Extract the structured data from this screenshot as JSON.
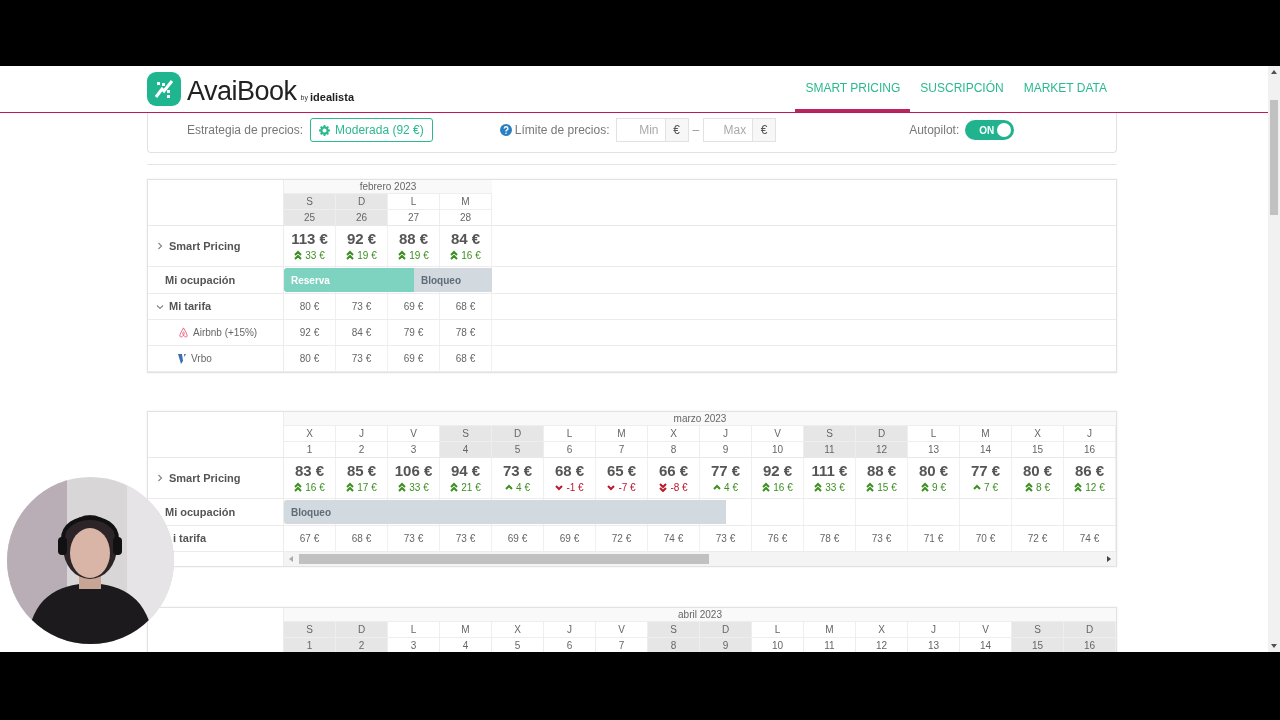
{
  "header": {
    "logo": {
      "name": "AvaiBook",
      "byline": "by",
      "partner": "idealista"
    },
    "nav": [
      {
        "label": "SMART PRICING",
        "selected": true
      },
      {
        "label": "SUSCRIPCIÓN",
        "selected": false
      },
      {
        "label": "MARKET DATA",
        "selected": false
      }
    ]
  },
  "settings": {
    "strategy_label": "Estrategia de precios:",
    "strategy_value": "Moderada (92 €)",
    "limit_label": "Límite de precios:",
    "min": {
      "placeholder": "Min",
      "unit": "€"
    },
    "separator": "–",
    "max": {
      "placeholder": "Max",
      "unit": "€"
    },
    "autopilot_label": "Autopilot:",
    "autopilot": {
      "on": true,
      "label": "ON"
    }
  },
  "sections": [
    {
      "month": "febrero 2023",
      "labels": {
        "smart_pricing": "Smart Pricing",
        "occupancy": "Mi ocupación",
        "rate": "Mi tarifa"
      },
      "smart_pricing_expanded": false,
      "rate_expanded": true,
      "bookings": [
        {
          "kind": "reserva",
          "label": "Reserva"
        },
        {
          "kind": "bloqueo",
          "label": "Bloqueo"
        }
      ],
      "channels": [
        {
          "kind": "airbnb",
          "label": "Airbnb (+15%)"
        },
        {
          "kind": "vrbo",
          "label": "Vrbo"
        }
      ],
      "days": [
        {
          "dow": "S",
          "day": "25",
          "weekend": true,
          "price": "113 €",
          "change": {
            "kind": "up2",
            "text": "33 €"
          },
          "rate": "80 €",
          "channel_prices": [
            "92 €",
            "80 €"
          ],
          "occupancy": [
            {
              "kind": "reserva"
            },
            {
              "kind": "reserva"
            }
          ]
        },
        {
          "dow": "D",
          "day": "26",
          "weekend": true,
          "price": "92 €",
          "change": {
            "kind": "up2",
            "text": "19 €"
          },
          "rate": "73 €",
          "channel_prices": [
            "84 €",
            "73 €"
          ],
          "occupancy": [
            {
              "kind": "reserva"
            },
            {
              "kind": "reserva"
            }
          ]
        },
        {
          "dow": "L",
          "day": "27",
          "weekend": false,
          "price": "88 €",
          "change": {
            "kind": "up2",
            "text": "19 €"
          },
          "rate": "69 €",
          "channel_prices": [
            "79 €",
            "69 €"
          ],
          "occupancy": [
            {
              "kind": "reserva"
            },
            {
              "kind": "bloqueo"
            }
          ]
        },
        {
          "dow": "M",
          "day": "28",
          "weekend": false,
          "price": "84 €",
          "change": {
            "kind": "up2",
            "text": "16 €"
          },
          "rate": "68 €",
          "channel_prices": [
            "78 €",
            "68 €"
          ],
          "occupancy": [
            {
              "kind": "bloqueo"
            },
            {
              "kind": "bloqueo"
            }
          ]
        }
      ]
    },
    {
      "month": "marzo 2023",
      "labels": {
        "smart_pricing": "Smart Pricing",
        "occupancy": "Mi ocupación",
        "rate": "i tarifa"
      },
      "smart_pricing_expanded": false,
      "horizontal_scroll": true,
      "bookings": [
        {
          "kind": "bloqueo",
          "label": "Bloqueo"
        }
      ],
      "days": [
        {
          "dow": "X",
          "day": "1",
          "weekend": false,
          "price": "83 €",
          "change": {
            "kind": "up2",
            "text": "16 €"
          },
          "rate": "67 €",
          "occupancy": [
            {
              "kind": "bloqueo"
            },
            {
              "kind": "bloqueo"
            }
          ]
        },
        {
          "dow": "J",
          "day": "2",
          "weekend": false,
          "price": "85 €",
          "change": {
            "kind": "up2",
            "text": "17 €"
          },
          "rate": "68 €",
          "occupancy": [
            {
              "kind": "bloqueo"
            },
            {
              "kind": "bloqueo"
            }
          ]
        },
        {
          "dow": "V",
          "day": "3",
          "weekend": false,
          "price": "106 €",
          "change": {
            "kind": "up2",
            "text": "33 €"
          },
          "rate": "73 €",
          "occupancy": [
            {
              "kind": "bloqueo"
            },
            {
              "kind": "bloqueo"
            }
          ]
        },
        {
          "dow": "S",
          "day": "4",
          "weekend": true,
          "price": "94 €",
          "change": {
            "kind": "up2",
            "text": "21 €"
          },
          "rate": "73 €",
          "occupancy": [
            {
              "kind": "bloqueo"
            },
            {
              "kind": "bloqueo"
            }
          ]
        },
        {
          "dow": "D",
          "day": "5",
          "weekend": true,
          "price": "73 €",
          "change": {
            "kind": "up1",
            "text": "4 €"
          },
          "rate": "69 €",
          "occupancy": [
            {
              "kind": "bloqueo"
            },
            {
              "kind": "bloqueo"
            }
          ]
        },
        {
          "dow": "L",
          "day": "6",
          "weekend": false,
          "price": "68 €",
          "change": {
            "kind": "down1",
            "text": "-1 €"
          },
          "rate": "69 €",
          "occupancy": [
            {
              "kind": "bloqueo"
            },
            {
              "kind": "bloqueo"
            }
          ]
        },
        {
          "dow": "M",
          "day": "7",
          "weekend": false,
          "price": "65 €",
          "change": {
            "kind": "down1",
            "text": "-7 €"
          },
          "rate": "72 €",
          "occupancy": [
            {
              "kind": "bloqueo"
            },
            {
              "kind": "bloqueo"
            }
          ]
        },
        {
          "dow": "X",
          "day": "8",
          "weekend": false,
          "price": "66 €",
          "change": {
            "kind": "down2",
            "text": "-8 €"
          },
          "rate": "74 €",
          "occupancy": [
            {
              "kind": "bloqueo"
            },
            {
              "kind": "bloqueo"
            }
          ]
        },
        {
          "dow": "J",
          "day": "9",
          "weekend": false,
          "price": "77 €",
          "change": {
            "kind": "up1",
            "text": "4 €"
          },
          "rate": "73 €",
          "occupancy": [
            {
              "kind": "bloqueo"
            },
            {
              "kind": "free"
            }
          ]
        },
        {
          "dow": "V",
          "day": "10",
          "weekend": false,
          "price": "92 €",
          "change": {
            "kind": "up2",
            "text": "16 €"
          },
          "rate": "76 €"
        },
        {
          "dow": "S",
          "day": "11",
          "weekend": true,
          "price": "111 €",
          "change": {
            "kind": "up2",
            "text": "33 €"
          },
          "rate": "78 €"
        },
        {
          "dow": "D",
          "day": "12",
          "weekend": true,
          "price": "88 €",
          "change": {
            "kind": "up2",
            "text": "15 €"
          },
          "rate": "73 €"
        },
        {
          "dow": "L",
          "day": "13",
          "weekend": false,
          "price": "80 €",
          "change": {
            "kind": "up2",
            "text": "9 €"
          },
          "rate": "71 €"
        },
        {
          "dow": "M",
          "day": "14",
          "weekend": false,
          "price": "77 €",
          "change": {
            "kind": "up1",
            "text": "7 €"
          },
          "rate": "70 €"
        },
        {
          "dow": "X",
          "day": "15",
          "weekend": false,
          "price": "80 €",
          "change": {
            "kind": "up2",
            "text": "8 €"
          },
          "rate": "72 €"
        },
        {
          "dow": "J",
          "day": "16",
          "weekend": false,
          "price": "86 €",
          "change": {
            "kind": "up2",
            "text": "12 €"
          },
          "rate": "74 €"
        }
      ]
    },
    {
      "month": "abril 2023",
      "days": [
        {
          "dow": "S",
          "day": "1",
          "weekend": true
        },
        {
          "dow": "D",
          "day": "2",
          "weekend": true
        },
        {
          "dow": "L",
          "day": "3",
          "weekend": false
        },
        {
          "dow": "M",
          "day": "4",
          "weekend": false
        },
        {
          "dow": "X",
          "day": "5",
          "weekend": false
        },
        {
          "dow": "J",
          "day": "6",
          "weekend": false
        },
        {
          "dow": "V",
          "day": "7",
          "weekend": false
        },
        {
          "dow": "S",
          "day": "8",
          "weekend": true
        },
        {
          "dow": "D",
          "day": "9",
          "weekend": true
        },
        {
          "dow": "L",
          "day": "10",
          "weekend": false
        },
        {
          "dow": "M",
          "day": "11",
          "weekend": false
        },
        {
          "dow": "X",
          "day": "12",
          "weekend": false
        },
        {
          "dow": "J",
          "day": "13",
          "weekend": false
        },
        {
          "dow": "V",
          "day": "14",
          "weekend": false
        },
        {
          "dow": "S",
          "day": "15",
          "weekend": true
        },
        {
          "dow": "D",
          "day": "16",
          "weekend": true
        }
      ]
    }
  ]
}
